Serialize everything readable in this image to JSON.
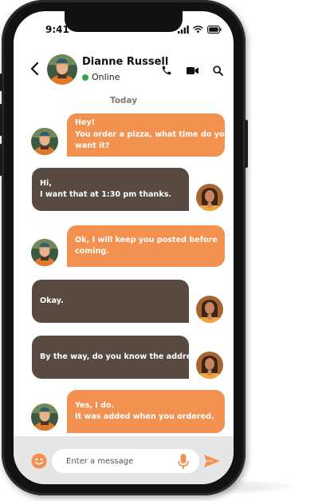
{
  "status_bar": {
    "time": "9:41"
  },
  "header": {
    "contact_name": "Dianne Russell",
    "presence": "Online"
  },
  "day_separator": "Today",
  "messages": [
    {
      "direction": "received",
      "lines": [
        "Hey!",
        "You order a pizza, what time do you",
        "want it?"
      ]
    },
    {
      "direction": "sent",
      "lines": [
        "Hi,",
        "I want that at 1:30 pm thanks."
      ]
    },
    {
      "direction": "received",
      "lines": [
        "Ok, I will keep you posted before",
        "coming."
      ]
    },
    {
      "direction": "sent",
      "lines": [
        "Okay."
      ]
    },
    {
      "direction": "sent",
      "lines": [
        "By the way, do you know the address?"
      ]
    },
    {
      "direction": "received",
      "lines": [
        "Yes, I do.",
        "It was added when you ordered."
      ]
    }
  ],
  "composer": {
    "placeholder": "Enter a message"
  },
  "colors": {
    "received_bubble": "#f29150",
    "sent_bubble": "#584a41",
    "presence_online": "#2ea84f",
    "accent": "#f29150"
  },
  "icons": {
    "back": "chevron-left-icon",
    "call": "phone-icon",
    "video": "video-camera-icon",
    "search": "search-icon",
    "emoji": "smiley-icon",
    "mic": "microphone-icon",
    "send": "send-icon",
    "signal": "signal-icon",
    "wifi": "wifi-icon",
    "battery": "battery-icon"
  }
}
